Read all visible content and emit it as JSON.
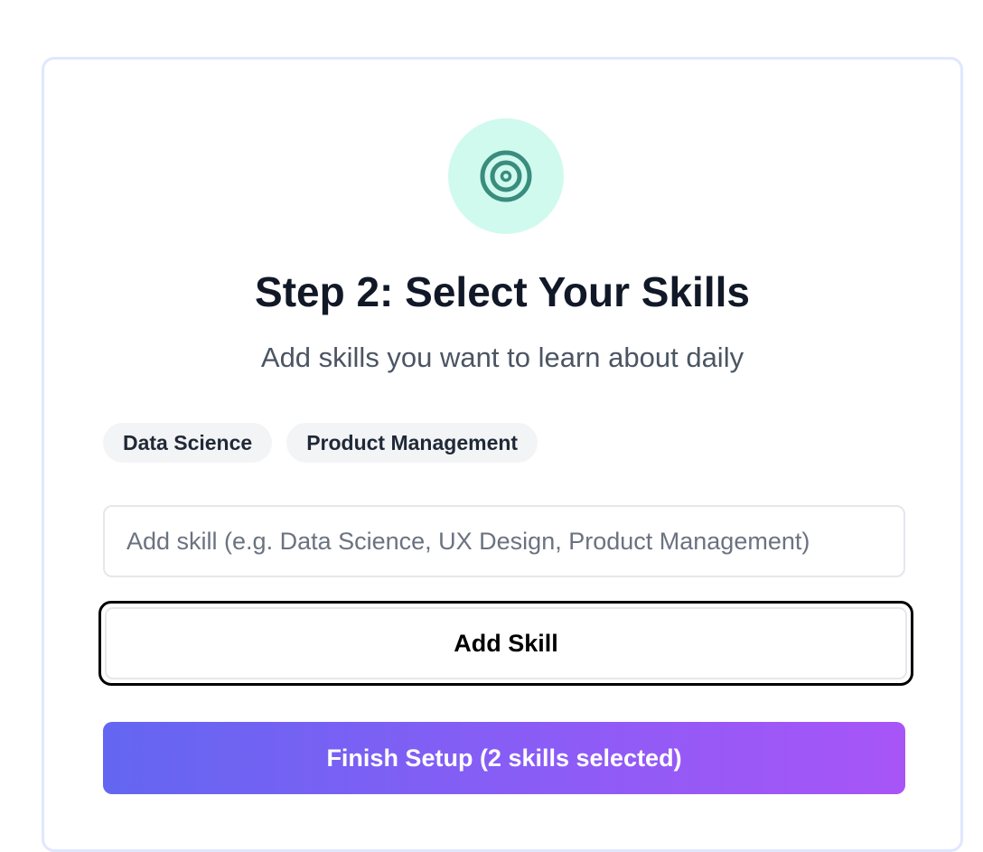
{
  "header": {
    "icon": "target-icon",
    "title": "Step 2: Select Your Skills",
    "subtitle": "Add skills you want to learn about daily"
  },
  "selected_skills": [
    {
      "label": "Data Science"
    },
    {
      "label": "Product Management"
    }
  ],
  "skill_input": {
    "value": "",
    "placeholder": "Add skill (e.g. Data Science, UX Design, Product Management)"
  },
  "add_button": {
    "label": "Add Skill"
  },
  "finish_button": {
    "label": "Finish Setup (2 skills selected)"
  },
  "colors": {
    "card_border": "#e0e7ff",
    "icon_bg": "#d1faef",
    "icon_fg": "#3a8c7e",
    "gradient_start": "#6366f1",
    "gradient_end": "#a855f7"
  }
}
